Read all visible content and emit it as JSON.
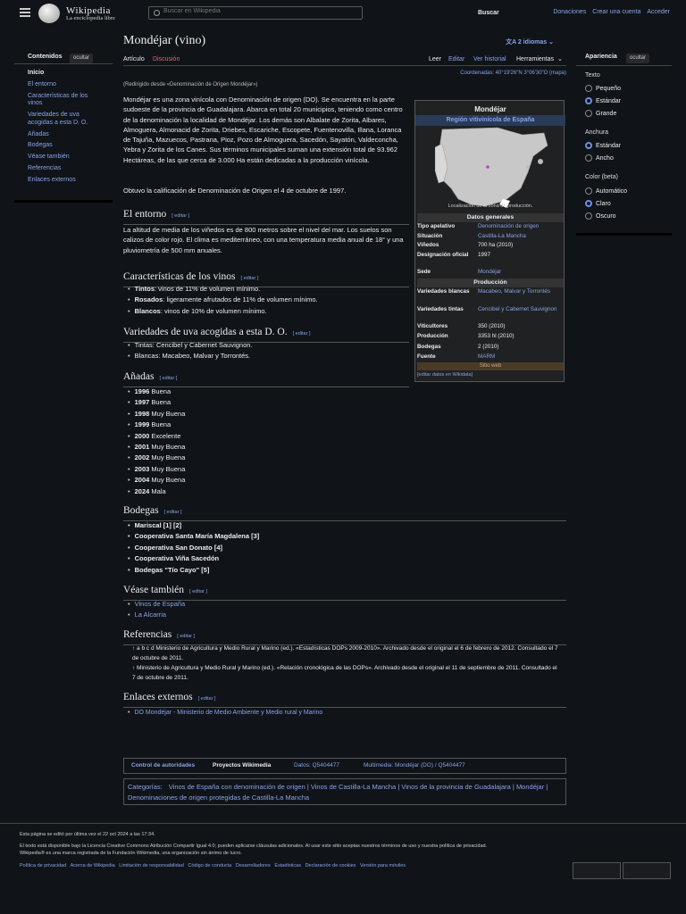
{
  "header": {
    "logo_title": "Wikipedia",
    "logo_sub": "La enciclopedia libre",
    "search_placeholder": "Buscar en Wikipedia",
    "search_button": "Buscar",
    "links": [
      "Donaciones",
      "Crear una cuenta",
      "Acceder"
    ]
  },
  "toc": {
    "title": "Contenidos",
    "hide": "ocultar",
    "items": [
      "Inicio",
      "El entorno",
      "Características de los vinos",
      "Variedades de uva acogidas a esta D. O.",
      "Añadas",
      "Bodegas",
      "Véase también",
      "Referencias",
      "Enlaces externos"
    ]
  },
  "article": {
    "title": "Mondéjar (vino)",
    "languages": "2 idiomas",
    "tabs": {
      "article": "Artículo",
      "discussion": "Discusión",
      "read": "Leer",
      "edit": "Editar",
      "history": "Ver historial",
      "tools": "Herramientas"
    },
    "coords": "Coordenadas: 40°19′26″N 3°06′30″O (mapa)",
    "redirect": "(Redirigido desde «Denominación de Origen Mondéjar»)",
    "intro": "Mondéjar es una zona vinícola con Denominación de origen (DO). Se encuentra en la parte sudoeste de la provincia de Guadalajara. Abarca en total 20 municipios, teniendo como centro de la denominación la localidad de Mondéjar. Los demás son Albalate de Zorita, Albares, Almoguera, Almonacid de Zorita, Driebes, Escariche, Escopete, Fuentenovilla, Illana, Loranca de Tajuña, Mazuecos, Pastrana, Pioz, Pozo de Almoguera, Sacedón, Sayatón, Valdeconcha, Yebra y Zorita de los Canes. Sus términos municipales suman una extensión total de 93.962 Hectáreas, de las que cerca de 3.000 Ha están dedicadas a la producción vinícola.",
    "intro2": "Obtuvo la calificación de Denominación de Origen el 4 de octubre de 1997.",
    "edit": "[ editar ]",
    "h_entorno": "El entorno",
    "entorno": "La altitud de media de los viñedos es de 800 metros sobre el nivel del mar. Los suelos son calizos de color rojo. El clima es mediterráneo, con una temperatura media anual de 18° y una pluviometría de 500 mm anuales.",
    "h_caract": "Características de los vinos",
    "caract": [
      [
        "Tintos",
        ": vinos de 11% de volumen mínimo."
      ],
      [
        "Rosados",
        ": ligeramente afrutados de 11% de volumen mínimo."
      ],
      [
        "Blancos",
        ": vinos de 10% de volumen mínimo."
      ]
    ],
    "h_variedades": "Variedades de uva acogidas a esta D. O.",
    "variedades": [
      "Tintas: Cencibel y Cabernet Sauvignon.",
      "Blancas: Macabeo, Malvar y Torrontés."
    ],
    "h_anadas": "Añadas",
    "anadas": [
      [
        "1996",
        "Buena"
      ],
      [
        "1997",
        "Buena"
      ],
      [
        "1998",
        "Muy Buena"
      ],
      [
        "1999",
        "Buena"
      ],
      [
        "2000",
        "Excelente"
      ],
      [
        "2001",
        "Muy Buena"
      ],
      [
        "2002",
        "Muy Buena"
      ],
      [
        "2003",
        "Muy Buena"
      ],
      [
        "2004",
        "Muy Buena"
      ],
      [
        "2024",
        "Mala"
      ]
    ],
    "h_bodegas": "Bodegas",
    "bodegas": [
      "Mariscal [1] [2]",
      "Cooperativa Santa María Magdalena [3]",
      "Cooperativa San Donato [4]",
      "Cooperativa Viña Sacedón",
      "Bodegas \"Tío Cayo\" [5]"
    ],
    "h_vease": "Véase también",
    "vease": [
      "Vinos de España",
      "La Alcarria"
    ],
    "h_refs": "Referencias",
    "refs": [
      "↑ a b c d Ministerio de Agricultura y Medio Rural y Marino (ed.). «Estadísticas DOPs 2009-2010». Archivado desde el original el 6 de febrero de 2012. Consultado el 7 de octubre de 2011.",
      "↑ Ministerio de Agricultura y Medio Rural y Marino (ed.). «Relación cronológica de las DOPs». Archivado desde el original el 11 de septiembre de 2011. Consultado el 7 de octubre de 2011."
    ],
    "h_enlaces": "Enlaces externos",
    "enlaces": [
      "DO Mondéjar - Ministerio de Medio Ambiente y Medio rural y Marino"
    ]
  },
  "infobox": {
    "title": "Mondéjar",
    "subtitle": "Región vitivinícola de España",
    "map_caption": "Localización de la zona de producción.",
    "sec1": "Datos generales",
    "rows1": [
      [
        "Tipo apelativo",
        "Denominación de origen"
      ],
      [
        "Situación",
        "Castilla-La Mancha"
      ],
      [
        "Viñedos",
        "700 ha (2010)"
      ],
      [
        "Designación oficial",
        "1997"
      ],
      [
        "Sede",
        "Mondéjar"
      ]
    ],
    "sec2": "Producción",
    "rows2": [
      [
        "Variedades blancas",
        "Macabeo, Malvar y Torrontés"
      ],
      [
        "Variedades tintas",
        "Cencibel y Cabernet Sauvignon"
      ],
      [
        "Viticultores",
        "350 (2010)"
      ],
      [
        "Producción",
        "3353 hl (2010)"
      ],
      [
        "Bodegas",
        "2 (2010)"
      ],
      [
        "Fuente",
        "MARM"
      ]
    ],
    "web": "Sitio web",
    "wikidata": "[editar datos en Wikidata]"
  },
  "appearance": {
    "title": "Apariencia",
    "hide": "ocultar",
    "text_label": "Texto",
    "text_opts": [
      "Pequeño",
      "Estándar",
      "Grande"
    ],
    "width_label": "Anchura",
    "width_opts": [
      "Estándar",
      "Ancho"
    ],
    "color_label": "Color (beta)",
    "color_opts": [
      "Automático",
      "Claro",
      "Oscuro"
    ]
  },
  "authority": {
    "label": "Control de autoridades",
    "wp": "Proyectos Wikimedia",
    "data": "Datos: Q5404477",
    "mm": "Multimedia: Mondéjar (DO) / Q5404477"
  },
  "categories": {
    "label": "Categorías:",
    "items": [
      "Vinos de España con denominación de origen",
      "Vinos de Castilla-La Mancha",
      "Vinos de la provincia de Guadalajara",
      "Mondéjar",
      "Denominaciones de origen protegidas de Castilla-La Mancha"
    ]
  },
  "footer": {
    "edited": "Esta página se editó por última vez el 22 oct 2024 a las 17:34.",
    "license": "El texto está disponible bajo la Licencia Creative Commons Atribución Compartir Igual 4.0; pueden aplicarse cláusulas adicionales. Al usar este sitio aceptas nuestros términos de uso y nuestra política de privacidad.",
    "trademark": "Wikipedia® es una marca registrada de la Fundación Wikimedia, una organización sin ánimo de lucro.",
    "links": [
      "Política de privacidad",
      "Acerca de Wikipedia",
      "Limitación de responsabilidad",
      "Código de conducta",
      "Desarrolladores",
      "Estadísticas",
      "Declaración de cookies",
      "Versión para móviles"
    ]
  }
}
